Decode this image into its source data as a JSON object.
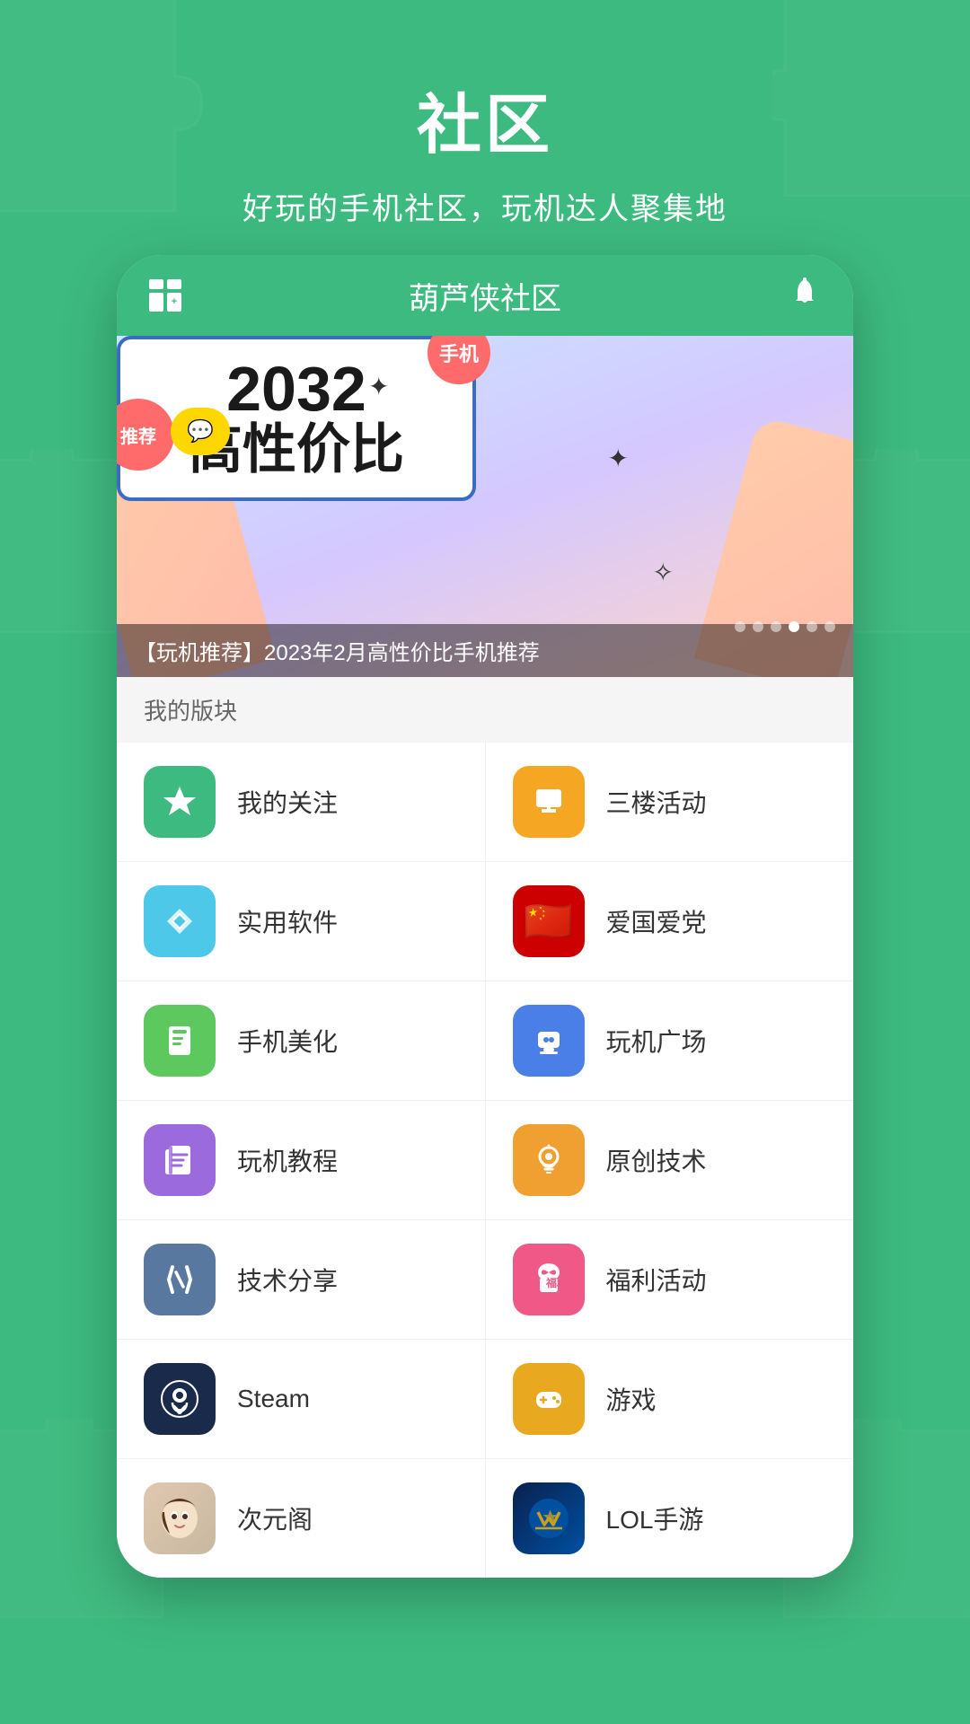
{
  "background": {
    "color": "#3dba7f"
  },
  "header": {
    "title": "社区",
    "subtitle": "好玩的手机社区，玩机达人聚集地"
  },
  "app_bar": {
    "grid_icon_label": "grid-plus-icon",
    "title": "葫芦侠社区",
    "bell_icon_label": "bell-icon"
  },
  "banner": {
    "year": "2032",
    "main_text": "高性价比",
    "badge_tuijian": "推荐",
    "badge_shouji": "手机",
    "caption": "【玩机推荐】2023年2月高性价比手机推荐",
    "dots_count": 6,
    "active_dot": 4
  },
  "sections": {
    "my_blocks_label": "我的版块"
  },
  "menu_items": [
    {
      "id": "guanzhu",
      "label": "我的关注",
      "icon": "star",
      "icon_color": "green"
    },
    {
      "id": "sanlou",
      "label": "三楼活动",
      "icon": "flag",
      "icon_color": "yellow"
    },
    {
      "id": "ruanjian",
      "label": "实用软件",
      "icon": "box",
      "icon_color": "cyan"
    },
    {
      "id": "aiguo",
      "label": "爱国爱党",
      "icon": "flag-china",
      "icon_color": "red"
    },
    {
      "id": "meihua",
      "label": "手机美化",
      "icon": "book",
      "icon_color": "light-green"
    },
    {
      "id": "wanjichang",
      "label": "玩机广场",
      "icon": "phone",
      "icon_color": "blue"
    },
    {
      "id": "jiaocheng",
      "label": "玩机教程",
      "icon": "bookmark",
      "icon_color": "purple"
    },
    {
      "id": "yuanchuang",
      "label": "原创技术",
      "icon": "bulb",
      "icon_color": "orange"
    },
    {
      "id": "jishu",
      "label": "技术分享",
      "icon": "wrench",
      "icon_color": "gray-blue"
    },
    {
      "id": "fuli",
      "label": "福利活动",
      "icon": "gift",
      "icon_color": "pink"
    },
    {
      "id": "steam",
      "label": "Steam",
      "icon": "steam",
      "icon_color": "dark-navy"
    },
    {
      "id": "youxi",
      "label": "游戏",
      "icon": "gamepad",
      "icon_color": "gold"
    },
    {
      "id": "ciyuan",
      "label": "次元阁",
      "icon": "anime",
      "icon_color": "anime"
    },
    {
      "id": "lol",
      "label": "LOL手游",
      "icon": "lol",
      "icon_color": "lol-blue"
    }
  ]
}
